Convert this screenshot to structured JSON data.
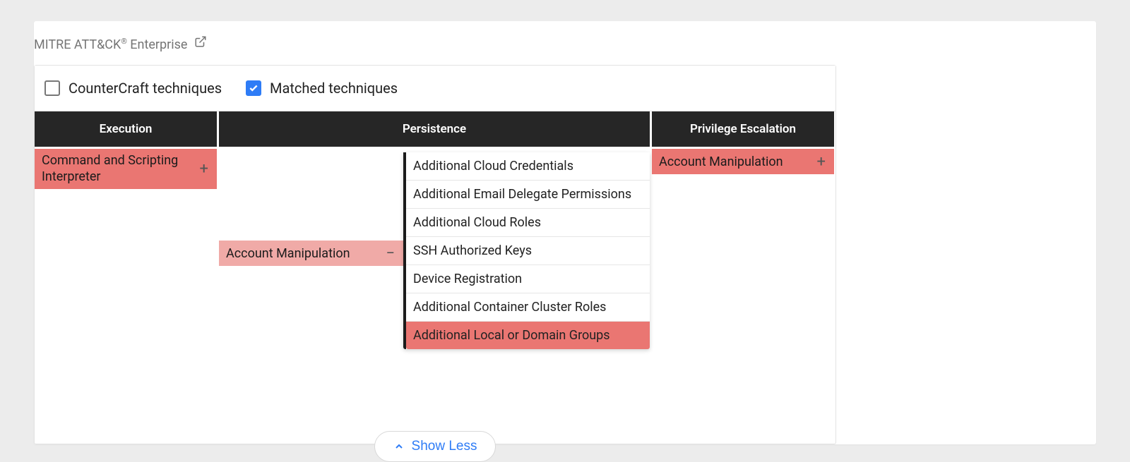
{
  "header": {
    "title_prefix": "MITRE ATT&CK",
    "title_suffix": " Enterprise"
  },
  "filters": {
    "countercraft": {
      "label": "CounterCraft techniques",
      "checked": false
    },
    "matched": {
      "label": "Matched techniques",
      "checked": true
    }
  },
  "columns": {
    "execution": "Execution",
    "persistence": "Persistence",
    "privilege_escalation": "Privilege Escalation"
  },
  "techniques": {
    "execution": {
      "label": "Command and Scripting Interpreter"
    },
    "persistence": {
      "label": "Account Manipulation",
      "subtechniques": [
        {
          "label": "Additional Cloud Credentials",
          "highlight": false
        },
        {
          "label": "Additional Email Delegate Permissions",
          "highlight": false
        },
        {
          "label": "Additional Cloud Roles",
          "highlight": false
        },
        {
          "label": "SSH Authorized Keys",
          "highlight": false
        },
        {
          "label": "Device Registration",
          "highlight": false
        },
        {
          "label": "Additional Container Cluster Roles",
          "highlight": false
        },
        {
          "label": "Additional Local or Domain Groups",
          "highlight": true
        }
      ]
    },
    "privilege_escalation": {
      "label": "Account Manipulation"
    }
  },
  "footer": {
    "show_less": "Show Less"
  }
}
